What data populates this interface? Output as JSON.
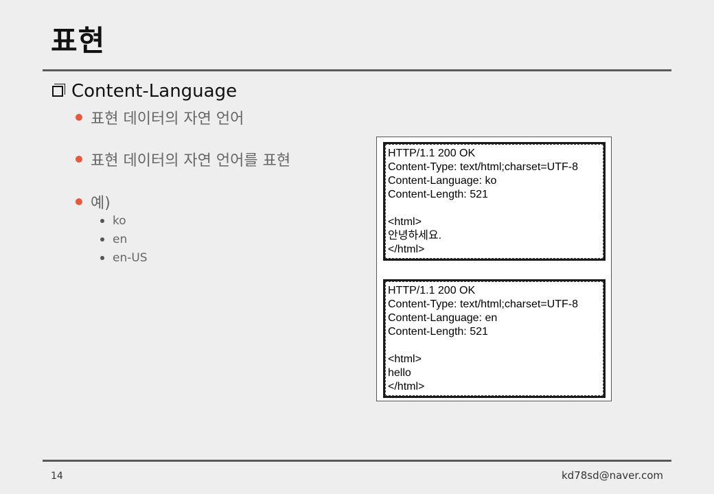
{
  "title": "표현",
  "section": "Content-Language",
  "bullets": [
    "표현 데이터의 자연 언어",
    "표현 데이터의 자연 언어를 표현",
    "예)"
  ],
  "sub_bullets": [
    "ko",
    "en",
    "en-US"
  ],
  "messages": [
    {
      "lines": [
        "HTTP/1.1 200 OK",
        "Content-Type: text/html;charset=UTF-8",
        "Content-Language: ko",
        "Content-Length: 521",
        "",
        "<html>",
        "안녕하세요.",
        "</html>"
      ]
    },
    {
      "lines": [
        "HTTP/1.1 200 OK",
        "Content-Type: text/html;charset=UTF-8",
        "Content-Language: en",
        "Content-Length: 521",
        "",
        "<html>",
        "hello",
        "</html>"
      ]
    }
  ],
  "footer": {
    "page": "14",
    "email": "kd78sd@naver.com"
  },
  "colors": {
    "bullet_accent": "#e65a3c",
    "background": "#eeeeee"
  }
}
